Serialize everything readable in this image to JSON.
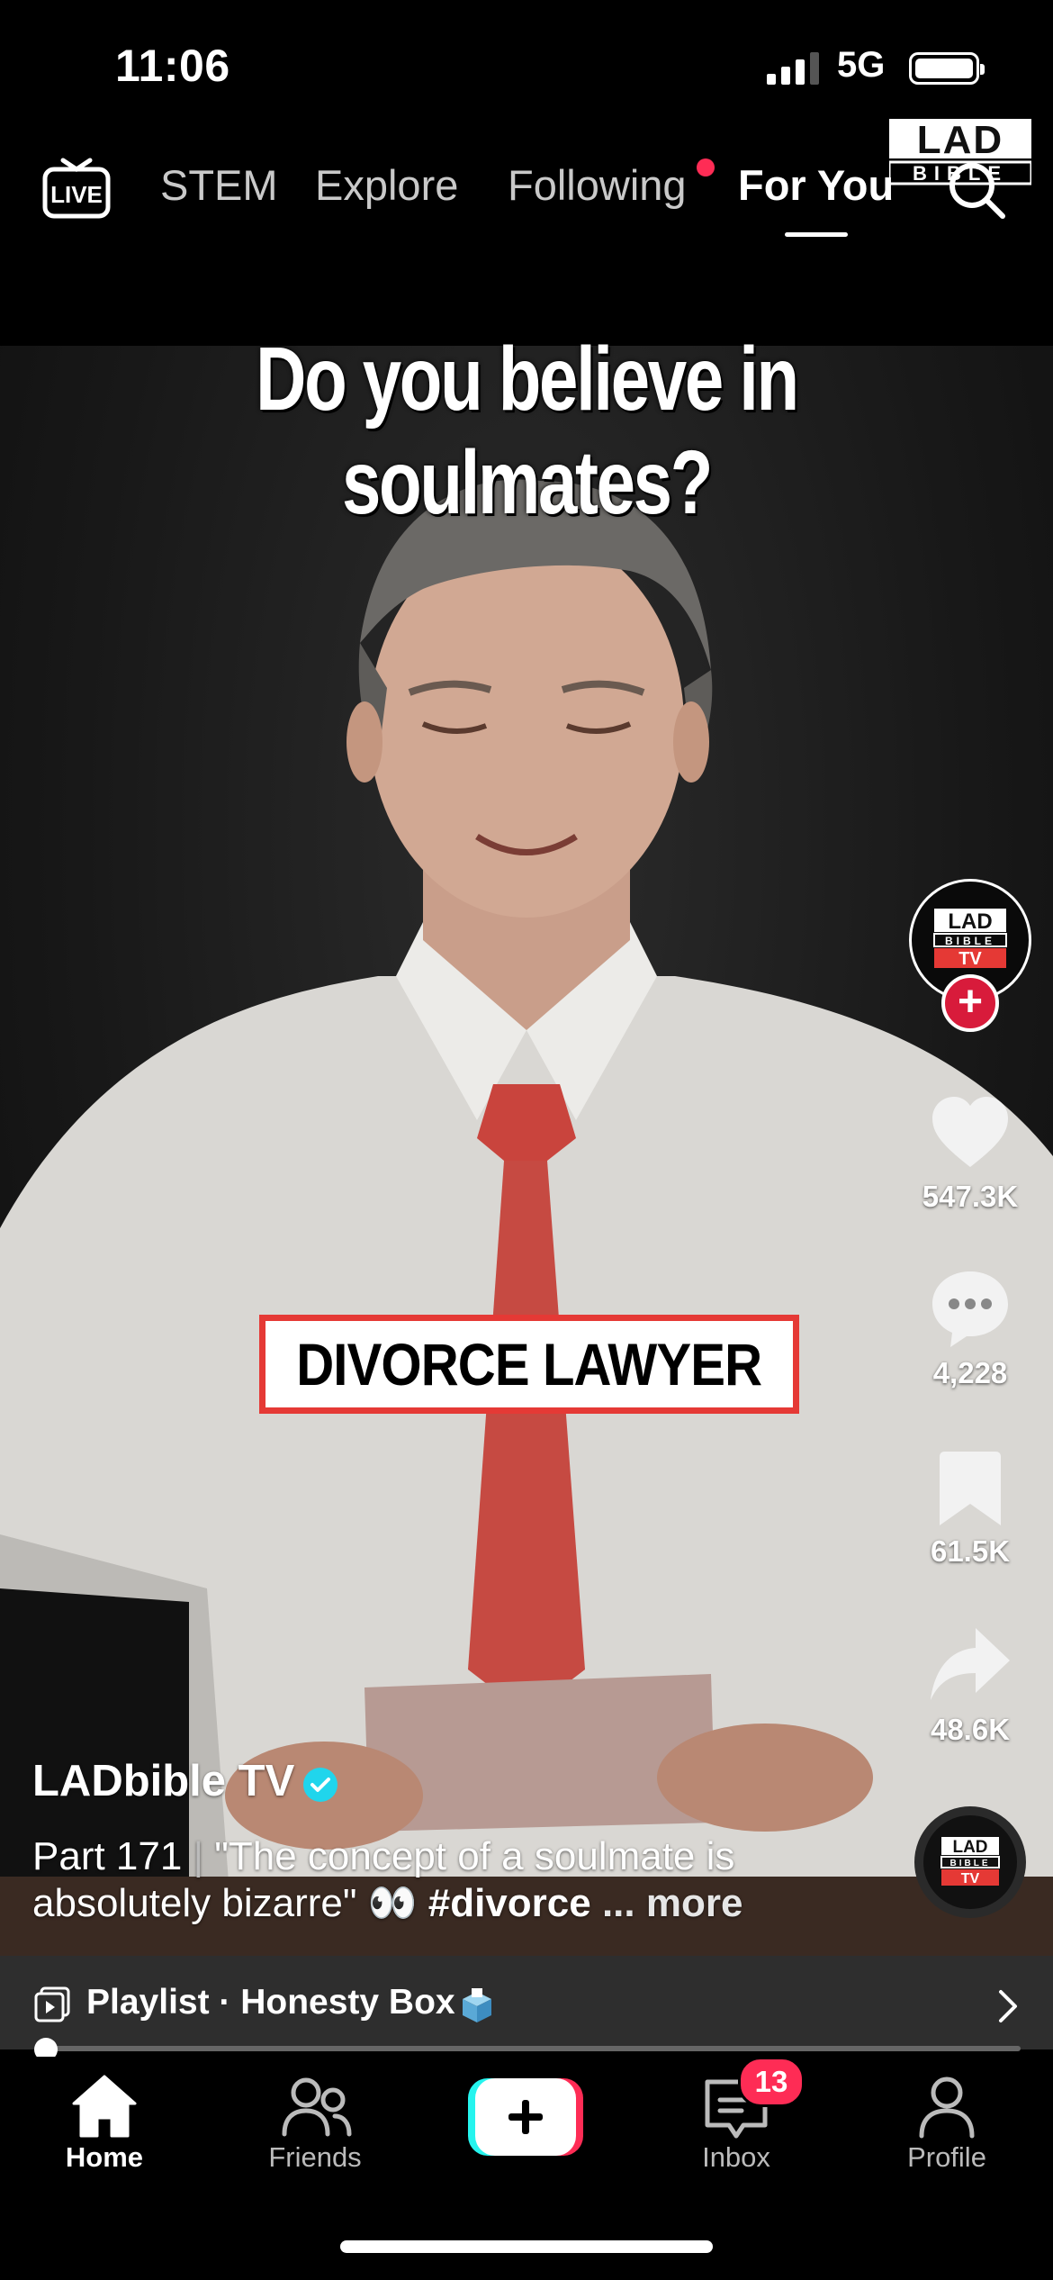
{
  "status_bar": {
    "time": "11:06",
    "network": "5G"
  },
  "top_nav": {
    "tabs": [
      {
        "label": "STEM",
        "active": false
      },
      {
        "label": "Explore",
        "active": false
      },
      {
        "label": "Following",
        "active": false,
        "has_notification_dot": true
      },
      {
        "label": "For You",
        "active": true
      }
    ],
    "live_icon_text": "LIVE",
    "search_icon": "search-icon"
  },
  "watermark": {
    "line1": "LAD",
    "line2": "BIBLE"
  },
  "video": {
    "headline": "Do you believe in soulmates?",
    "lower_third": "DIVORCE LAWYER"
  },
  "right_rail": {
    "avatar_logo": {
      "line1": "LAD",
      "line2": "BIBLE",
      "line3": "TV"
    },
    "likes": "547.3K",
    "comments": "4,228",
    "saves": "61.5K",
    "shares": "48.6K"
  },
  "post": {
    "author": "LADbible TV",
    "verified": true,
    "caption_prefix": "Part 171",
    "caption_separator": "|",
    "caption_quote": "\"The concept of a soulmate is absolutely bizarre\"",
    "caption_emoji": "👀",
    "hashtag": "#divorce",
    "more_label": "... more"
  },
  "playlist": {
    "label": "Playlist · Honesty Box"
  },
  "progress": {
    "fraction": 0.01
  },
  "bottom_nav": {
    "items": [
      {
        "label": "Home",
        "active": true
      },
      {
        "label": "Friends",
        "active": false
      },
      {
        "label": "",
        "active": false
      },
      {
        "label": "Inbox",
        "active": false,
        "badge": "13"
      },
      {
        "label": "Profile",
        "active": false
      }
    ]
  },
  "colors": {
    "accent_red": "#fe2c55",
    "label_border": "#e53935",
    "verified_blue": "#20d5ec"
  }
}
